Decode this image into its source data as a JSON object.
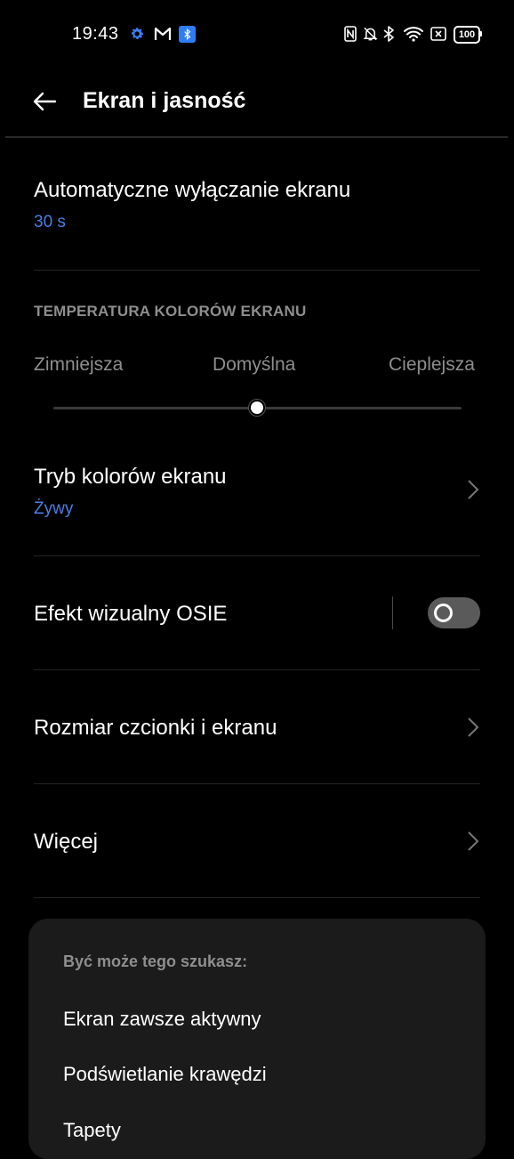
{
  "status_bar": {
    "time": "19:43",
    "left_icons": [
      "gear-icon",
      "gmail-icon",
      "bluetooth-app-icon"
    ],
    "right_icons": [
      "nfc-icon",
      "bell-off-icon",
      "bluetooth-icon",
      "wifi-icon",
      "x-box-icon"
    ],
    "battery": "100"
  },
  "header": {
    "back_icon": "arrow-left-icon",
    "title": "Ekran i jasność"
  },
  "auto_off": {
    "title": "Automatyczne wyłączanie ekranu",
    "value": "30 s"
  },
  "color_temperature": {
    "section_title": "TEMPERATURA KOLORÓW EKRANU",
    "labels": [
      "Zimniejsza",
      "Domyślna",
      "Cieplejsza"
    ],
    "value": 0.5
  },
  "color_mode": {
    "title": "Tryb kolorów ekranu",
    "value": "Żywy"
  },
  "osie": {
    "title": "Efekt wizualny OSIE",
    "enabled": false
  },
  "font_size": {
    "title": "Rozmiar czcionki i ekranu"
  },
  "more": {
    "title": "Więcej"
  },
  "suggestions": {
    "header": "Być może tego szukasz:",
    "items": [
      "Ekran zawsze aktywny",
      "Podświetlanie krawędzi",
      "Tapety"
    ]
  },
  "colors": {
    "background": "#000000",
    "accent": "#4a7fe4",
    "secondary_text": "#8e8e8e",
    "card": "#1b1b1b"
  }
}
